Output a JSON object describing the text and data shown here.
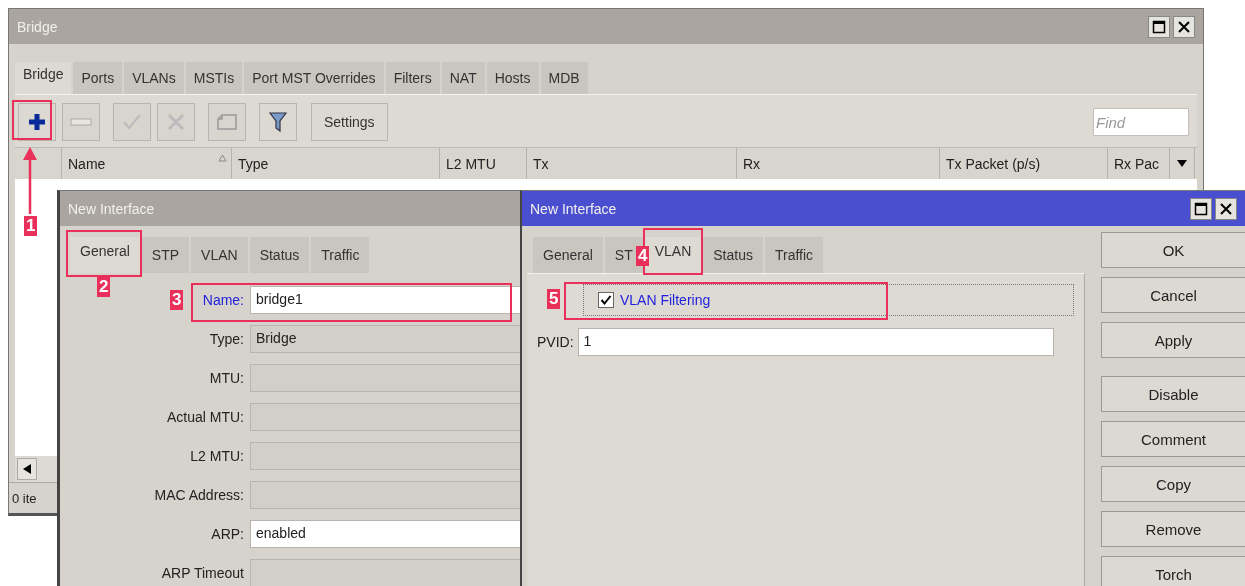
{
  "bridge_window": {
    "title": "Bridge",
    "tabs": [
      {
        "label": "Bridge",
        "selected": true
      },
      {
        "label": "Ports",
        "selected": false
      },
      {
        "label": "VLANs",
        "selected": false
      },
      {
        "label": "MSTIs",
        "selected": false
      },
      {
        "label": "Port MST Overrides",
        "selected": false
      },
      {
        "label": "Filters",
        "selected": false
      },
      {
        "label": "NAT",
        "selected": false
      },
      {
        "label": "Hosts",
        "selected": false
      },
      {
        "label": "MDB",
        "selected": false
      }
    ],
    "toolbar": [
      {
        "kind": "add",
        "disabled": false
      },
      {
        "kind": "remove",
        "disabled": true
      },
      {
        "kind": "enable",
        "disabled": true
      },
      {
        "kind": "disable",
        "disabled": true
      },
      {
        "kind": "comment",
        "disabled": true
      },
      {
        "kind": "filter",
        "disabled": false
      },
      {
        "kind": "settings",
        "label": "Settings",
        "disabled": false
      }
    ],
    "find": {
      "placeholder": "Find"
    },
    "table": {
      "columns": [
        {
          "label": "Name",
          "sorted": true
        },
        {
          "label": "Type",
          "sorted": false
        },
        {
          "label": "L2 MTU",
          "sorted": false
        },
        {
          "label": "Tx",
          "sorted": false
        },
        {
          "label": "Rx",
          "sorted": false
        },
        {
          "label": "Tx Packet (p/s)",
          "sorted": false
        },
        {
          "label": "Rx Pac",
          "sorted": false
        }
      ]
    },
    "status_bar": "0 ite"
  },
  "general_window": {
    "title": "New Interface",
    "active": false,
    "tabs": [
      {
        "label": "General",
        "selected": true
      },
      {
        "label": "STP",
        "selected": false
      },
      {
        "label": "VLAN",
        "selected": false
      },
      {
        "label": "Status",
        "selected": false
      },
      {
        "label": "Traffic",
        "selected": false
      }
    ],
    "fields": [
      {
        "label": "Name:",
        "value": "bridge1",
        "editable": true,
        "focused": true
      },
      {
        "label": "Type:",
        "value": "Bridge",
        "editable": false,
        "focused": false
      },
      {
        "label": "MTU:",
        "editable": false,
        "focused": false
      },
      {
        "label": "Actual MTU:",
        "editable": false,
        "focused": false
      },
      {
        "label": "L2 MTU:",
        "editable": false,
        "focused": false
      },
      {
        "label": "MAC Address:",
        "editable": false,
        "focused": false
      },
      {
        "label": "ARP:",
        "value": "enabled",
        "editable": true,
        "focused": false
      },
      {
        "label": "ARP Timeout",
        "editable": false,
        "focused": false
      }
    ]
  },
  "vlan_window": {
    "title": "New Interface",
    "active": true,
    "tabs": [
      {
        "label": "General",
        "selected": false
      },
      {
        "label": "ST",
        "selected": false
      },
      {
        "label": "VLAN",
        "selected": true
      },
      {
        "label": "Status",
        "selected": false
      },
      {
        "label": "Traffic",
        "selected": false
      }
    ],
    "vlan_filtering": {
      "label": "VLAN Filtering",
      "checked": true,
      "focused": true
    },
    "pvid": {
      "label": "PVID:",
      "value": "1"
    },
    "buttons": [
      "OK",
      "Cancel",
      "Apply",
      "Disable",
      "Comment",
      "Copy",
      "Remove",
      "Torch"
    ]
  },
  "annotations": [
    {
      "number": "1"
    },
    {
      "number": "2"
    },
    {
      "number": "3"
    },
    {
      "number": "4"
    },
    {
      "number": "5"
    }
  ]
}
